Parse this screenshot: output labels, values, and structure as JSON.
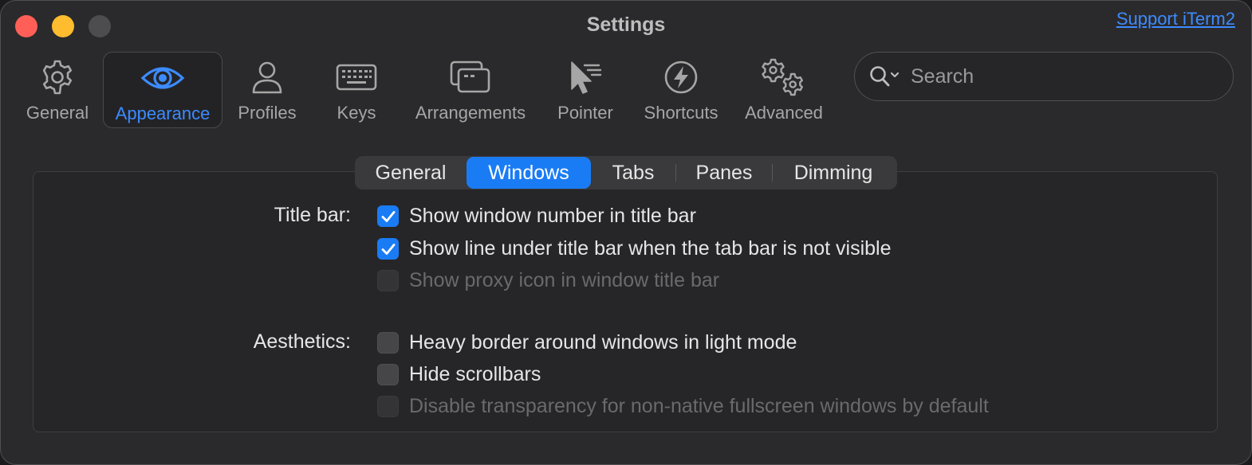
{
  "window": {
    "title": "Settings",
    "support_link": "Support iTerm2"
  },
  "toolbar": {
    "items": [
      {
        "label": "General",
        "icon": "gear-icon"
      },
      {
        "label": "Appearance",
        "icon": "eye-icon",
        "selected": true
      },
      {
        "label": "Profiles",
        "icon": "person-icon"
      },
      {
        "label": "Keys",
        "icon": "keyboard-icon"
      },
      {
        "label": "Arrangements",
        "icon": "windows-icon"
      },
      {
        "label": "Pointer",
        "icon": "pointer-icon"
      },
      {
        "label": "Shortcuts",
        "icon": "bolt-icon"
      },
      {
        "label": "Advanced",
        "icon": "gears-icon"
      }
    ],
    "search": {
      "placeholder": "Search",
      "value": ""
    }
  },
  "tabs": {
    "items": [
      "General",
      "Windows",
      "Tabs",
      "Panes",
      "Dimming"
    ],
    "selected": "Windows"
  },
  "sections": {
    "title_bar": {
      "label": "Title bar:",
      "options": [
        {
          "label": "Show window number in title bar",
          "state": "checked"
        },
        {
          "label": "Show line under title bar when the tab bar is not visible",
          "state": "checked"
        },
        {
          "label": "Show proxy icon in window title bar",
          "state": "disabled"
        }
      ]
    },
    "aesthetics": {
      "label": "Aesthetics:",
      "options": [
        {
          "label": "Heavy border around windows in light mode",
          "state": "unchecked"
        },
        {
          "label": "Hide scrollbars",
          "state": "unchecked"
        },
        {
          "label": "Disable transparency for non-native fullscreen windows by default",
          "state": "disabled"
        }
      ]
    }
  },
  "colors": {
    "accent": "#1a7cf5",
    "link": "#3d8bff",
    "background": "#2a2a2c"
  }
}
